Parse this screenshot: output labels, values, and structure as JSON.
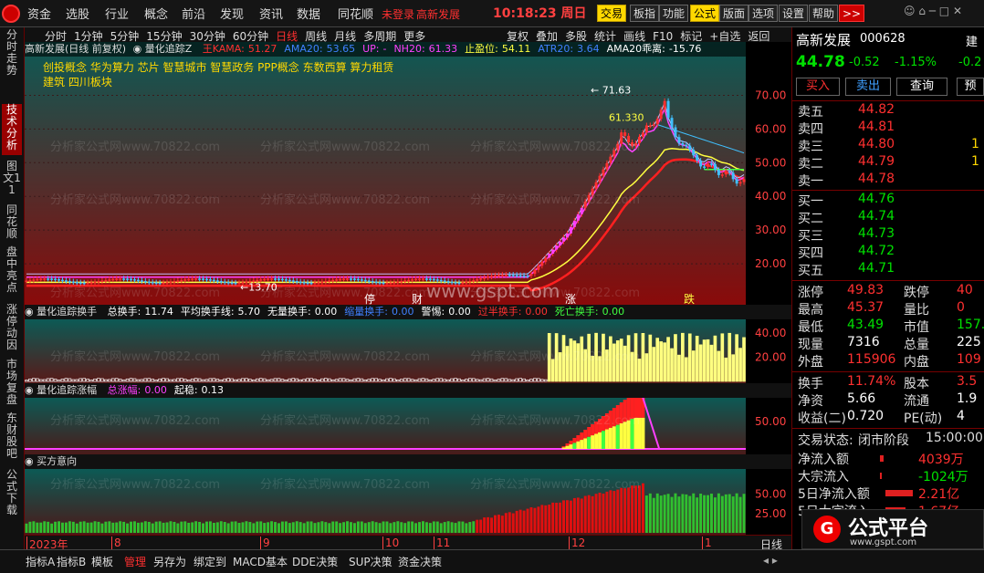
{
  "topbar": {
    "menus": [
      "资金",
      "选股",
      "行业",
      "概念",
      "前沿",
      "发现",
      "资讯",
      "数据",
      "同花顺"
    ],
    "login": "未登录",
    "stock": "高新发展",
    "time": "10:18:23",
    "weekday": "周日",
    "buttons": [
      "交易",
      "板指",
      "功能",
      "公式",
      "版面",
      "选项",
      "设置",
      "帮助",
      ">>"
    ]
  },
  "leftbar": [
    "分时走势",
    "技术分析",
    "图文11",
    "同花顺",
    "盘中亮点",
    "涨停动因",
    "市场复盘",
    "东财股吧",
    "公式下载"
  ],
  "chart": {
    "periods": [
      "分时",
      "1分钟",
      "5分钟",
      "15分钟",
      "30分钟",
      "60分钟",
      "日线",
      "周线",
      "月线",
      "多周期"
    ],
    "more": "更多",
    "tools": [
      "复权",
      "叠加",
      "多股",
      "统计",
      "画线",
      "F10",
      "标记",
      "+自选",
      "返回"
    ],
    "main_title": "高新发展(日线 前复权)",
    "main_indicator": "量化追踪Z",
    "main_params": [
      {
        "k": "王KAMA:",
        "v": "51.27",
        "c": "#ff3030"
      },
      {
        "k": "AMA20:",
        "v": "53.65",
        "c": "#4080ff"
      },
      {
        "k": "UP:",
        "v": "-",
        "c": "#ff40ff"
      },
      {
        "k": "NH20:",
        "v": "61.33",
        "c": "#ff40ff"
      },
      {
        "k": "止盈位:",
        "v": "54.11",
        "c": "#ffff40"
      },
      {
        "k": "ATR20:",
        "v": "3.64",
        "c": "#4080ff"
      },
      {
        "k": "AMA20乖离:",
        "v": "-15.76",
        "c": "#ffffff"
      }
    ],
    "concepts": [
      "创投概念 华为算力 芯片 智慧城市 智慧政务 PPP概念 东数西算 算力租赁",
      "建筑    四川板块"
    ],
    "price_axis": [
      "70.00",
      "60.00",
      "50.00",
      "40.00",
      "30.00",
      "20.00"
    ],
    "label_high": "71.63",
    "label_nh": "61.330",
    "label_low": "13.70",
    "event_labels": [
      "停",
      "财",
      "涨",
      "跌"
    ],
    "watermark": "分析家公式网www.70822.com",
    "gspt": "www.gspt.com",
    "pane2_title": "量化追踪换手",
    "pane2_params": [
      {
        "k": "总换手:",
        "v": "11.74",
        "c": "#ffffff"
      },
      {
        "k": "平均换手线:",
        "v": "5.70",
        "c": "#ffffff"
      },
      {
        "k": "无量换手:",
        "v": "0.00",
        "c": "#ffffff"
      },
      {
        "k": "缩量换手:",
        "v": "0.00",
        "c": "#4080ff"
      },
      {
        "k": "警惕:",
        "v": "0.00",
        "c": "#ffffff"
      },
      {
        "k": "过半换手:",
        "v": "0.00",
        "c": "#ff3030"
      },
      {
        "k": "死亡换手:",
        "v": "0.00",
        "c": "#40ff40"
      }
    ],
    "pane2_axis": [
      "40.00",
      "20.00"
    ],
    "pane3_title": "量化追踪涨幅",
    "pane3_params": [
      {
        "k": "总涨幅:",
        "v": "0.00",
        "c": "#ff40ff"
      },
      {
        "k": "起稳:",
        "v": "0.13",
        "c": "#ffffff"
      }
    ],
    "pane3_axis": [
      "50.00"
    ],
    "pane4_title": "买方意向",
    "pane4_axis": [
      "50.00",
      "25.00"
    ],
    "time_axis": [
      "2023年",
      "8",
      "9",
      "10",
      "11",
      "12",
      "1"
    ],
    "period_label": "日线"
  },
  "right": {
    "name": "高新发展",
    "code": "000628",
    "partial": "建",
    "price": "44.78",
    "change": "-0.52",
    "pct": "-1.15%",
    "partial_pct": "-0.2",
    "buttons": [
      "买入",
      "卖出",
      "查询",
      "预"
    ],
    "sells": [
      {
        "l": "卖五",
        "p": "44.82",
        "v": ""
      },
      {
        "l": "卖四",
        "p": "44.81",
        "v": ""
      },
      {
        "l": "卖三",
        "p": "44.80",
        "v": "1"
      },
      {
        "l": "卖二",
        "p": "44.79",
        "v": "1"
      },
      {
        "l": "卖一",
        "p": "44.78",
        "v": ""
      }
    ],
    "buys": [
      {
        "l": "买一",
        "p": "44.76",
        "v": ""
      },
      {
        "l": "买二",
        "p": "44.74",
        "v": ""
      },
      {
        "l": "买三",
        "p": "44.73",
        "v": ""
      },
      {
        "l": "买四",
        "p": "44.72",
        "v": ""
      },
      {
        "l": "买五",
        "p": "44.71",
        "v": ""
      }
    ],
    "stats": [
      {
        "l": "涨停",
        "v": "49.83",
        "l2": "跌停",
        "v2": "40"
      },
      {
        "l": "最高",
        "v": "45.37",
        "l2": "量比",
        "v2": "0"
      },
      {
        "l": "最低",
        "v": "43.49",
        "l2": "市值",
        "v2": "157."
      },
      {
        "l": "现量",
        "v": "7316",
        "l2": "总量",
        "v2": "225"
      },
      {
        "l": "外盘",
        "v": "115906",
        "l2": "内盘",
        "v2": "109"
      }
    ],
    "stats2": [
      {
        "l": "换手",
        "v": "11.74%",
        "l2": "股本",
        "v2": "3.5"
      },
      {
        "l": "净资",
        "v": "5.66",
        "l2": "流通",
        "v2": "1.9"
      },
      {
        "l": "收益(二)",
        "v": "0.720",
        "l2": "PE(动)",
        "v2": "4"
      }
    ],
    "status": {
      "label": "交易状态:",
      "value": "闭市阶段",
      "time": "15:00:00"
    },
    "flows": [
      {
        "l": "净流入额",
        "v": "4039万"
      },
      {
        "l": "大宗流入",
        "v": "-1024万"
      },
      {
        "l": "5日净流入额",
        "v": "2.21亿"
      },
      {
        "l": "5日大宗流入",
        "v": "1.67亿"
      }
    ],
    "brand": "公式平台",
    "brand_url": "www.gspt.com"
  },
  "bottom": {
    "tabs": [
      "指标A",
      "指标B",
      "模板",
      "管理",
      "另存为",
      "绑定到",
      "MACD基本",
      "DDE决策",
      "SUP决策",
      "资金决策"
    ]
  }
}
